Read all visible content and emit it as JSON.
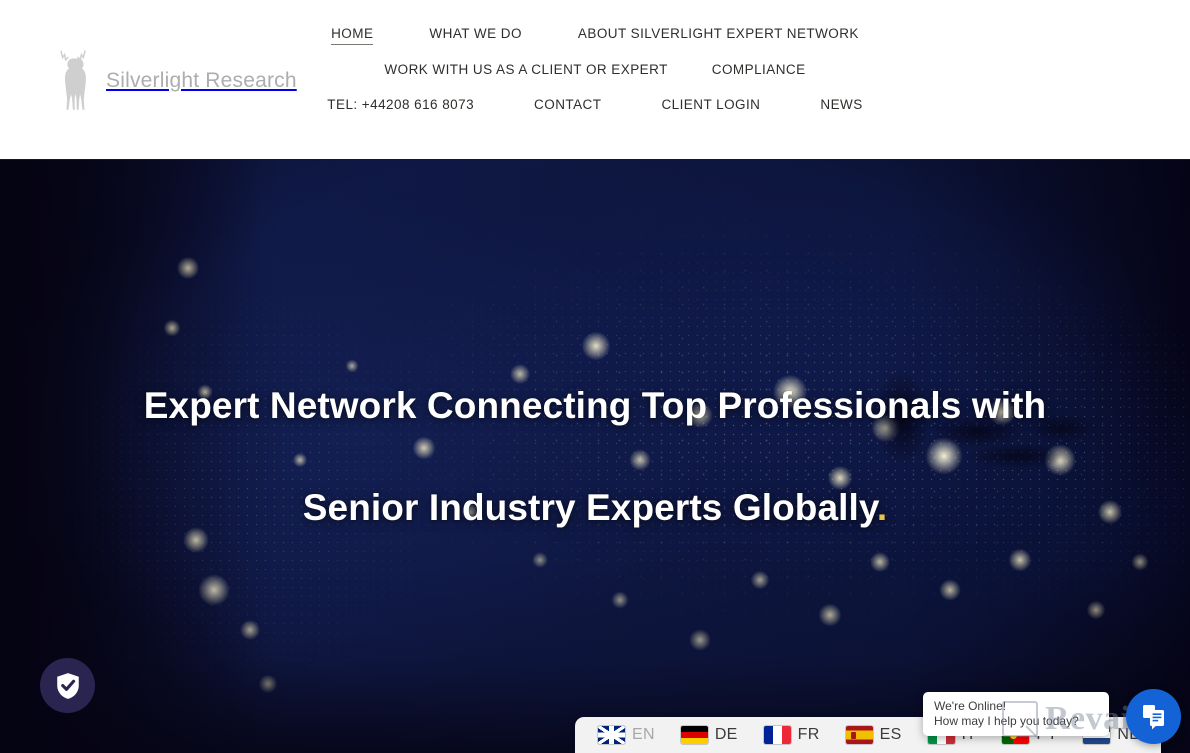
{
  "brand": {
    "name": "Silverlight Research",
    "logo_icon": "stag-logo-icon"
  },
  "nav": {
    "rows": [
      [
        {
          "label": "HOME",
          "active": true
        },
        {
          "label": "WHAT WE DO",
          "active": false
        },
        {
          "label": "ABOUT SILVERLIGHT EXPERT NETWORK",
          "active": false
        }
      ],
      [
        {
          "label": "WORK WITH US AS A CLIENT OR EXPERT",
          "active": false
        },
        {
          "label": "COMPLIANCE",
          "active": false
        }
      ],
      [
        {
          "label": "TEL: +44208 616 8073",
          "active": false
        },
        {
          "label": "CONTACT",
          "active": false
        },
        {
          "label": "CLIENT LOGIN",
          "active": false
        },
        {
          "label": "NEWS",
          "active": false
        }
      ]
    ]
  },
  "hero": {
    "line1": "Expert Network Connecting Top Professionals with",
    "line2_main": "Senior Industry Experts Globally",
    "line2_accent": ".",
    "accent_color": "#e9c24b",
    "background_description": "night satellite view of North America with city lights"
  },
  "privacy_badge": {
    "icon": "shield-check-icon",
    "background_color": "#2a2450"
  },
  "language_bar": {
    "items": [
      {
        "code": "EN",
        "flag": "gb",
        "active": true
      },
      {
        "code": "DE",
        "flag": "de",
        "active": false
      },
      {
        "code": "FR",
        "flag": "fr",
        "active": false
      },
      {
        "code": "ES",
        "flag": "es",
        "active": false
      },
      {
        "code": "IT",
        "flag": "it",
        "active": false
      },
      {
        "code": "PT",
        "flag": "pt",
        "active": false
      },
      {
        "code": "NL",
        "flag": "nl",
        "active": false
      }
    ]
  },
  "chat": {
    "line1": "We're Online!",
    "line2": "How may I help you today?",
    "button_icon": "chat-documents-icon",
    "button_color": "#1463d6"
  },
  "watermark": {
    "text": "Revain"
  }
}
